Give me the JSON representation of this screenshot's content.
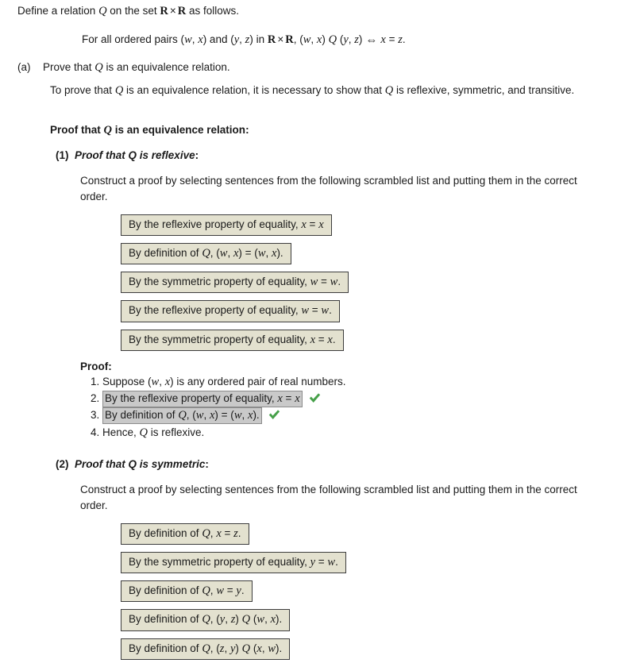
{
  "problem": {
    "intro_prefix": "Define a relation ",
    "intro_var": "Q",
    "intro_mid": " on the set ",
    "intro_set_a": "R",
    "intro_times": "×",
    "intro_set_b": "R",
    "intro_suffix": " as follows.",
    "definition": {
      "t1": "For all ordered pairs (",
      "v1": "w",
      "t2": ", ",
      "v2": "x",
      "t3": ") and (",
      "v3": "y",
      "t4": ", ",
      "v4": "z",
      "t5": ") in ",
      "setA": "R",
      "times": "×",
      "setB": "R",
      "t6": ", (",
      "v5": "w",
      "t7": ", ",
      "v6": "x",
      "t8": ") ",
      "rel1": "Q",
      "t9": " (",
      "v7": "y",
      "t10": ", ",
      "v8": "z",
      "t11": ")",
      "iff": "⇔",
      "v9": "x",
      "t12": " = ",
      "v10": "z",
      "t13": "."
    }
  },
  "part_a": {
    "marker": "(a)",
    "prompt_prefix": "Prove that ",
    "prompt_var": "Q",
    "prompt_suffix": " is an equivalence relation.",
    "to_prove_1": "To prove that ",
    "to_prove_var1": "Q",
    "to_prove_2": " is an equivalence relation, it is necessary to show that ",
    "to_prove_var2": "Q",
    "to_prove_3": " is reflexive, symmetric, and transitive.",
    "proof_heading_1": "Proof that ",
    "proof_heading_var": "Q",
    "proof_heading_2": " is an equivalence relation",
    "proof_heading_colon": ":"
  },
  "sections": [
    {
      "number": "(1)",
      "title_prefix": "Proof that ",
      "title_var": "Q",
      "title_suffix": " is reflexive",
      "title_colon": ":",
      "construct_text": "Construct a proof by selecting sentences from the following scrambled list and putting them in the correct order.",
      "scrambled": [
        {
          "parts": [
            {
              "t": "By the reflexive property of equality, "
            },
            {
              "i": "x"
            },
            {
              "t": " = "
            },
            {
              "i": "x"
            }
          ]
        },
        {
          "parts": [
            {
              "t": "By definition of "
            },
            {
              "i": "Q"
            },
            {
              "t": ", ("
            },
            {
              "i": "w"
            },
            {
              "t": ", "
            },
            {
              "i": "x"
            },
            {
              "t": ") = ("
            },
            {
              "i": "w"
            },
            {
              "t": ", "
            },
            {
              "i": "x"
            },
            {
              "t": ")."
            }
          ]
        },
        {
          "parts": [
            {
              "t": "By the symmetric property of equality, "
            },
            {
              "i": "w"
            },
            {
              "t": " = "
            },
            {
              "i": "w"
            },
            {
              "t": "."
            }
          ]
        },
        {
          "parts": [
            {
              "t": "By the reflexive property of equality, "
            },
            {
              "i": "w"
            },
            {
              "t": " = "
            },
            {
              "i": "w"
            },
            {
              "t": "."
            }
          ]
        },
        {
          "parts": [
            {
              "t": "By the symmetric property of equality, "
            },
            {
              "i": "x"
            },
            {
              "t": " = "
            },
            {
              "i": "x"
            },
            {
              "t": "."
            }
          ]
        }
      ],
      "proof_label": "Proof:",
      "proof_steps": [
        {
          "filled": false,
          "checked": false,
          "parts": [
            {
              "t": "Suppose ("
            },
            {
              "i": "w"
            },
            {
              "t": ", "
            },
            {
              "i": "x"
            },
            {
              "t": ") is any ordered pair of real numbers."
            }
          ]
        },
        {
          "filled": true,
          "checked": true,
          "parts": [
            {
              "t": "By the reflexive property of equality, "
            },
            {
              "i": "x"
            },
            {
              "t": " = "
            },
            {
              "i": "x"
            }
          ]
        },
        {
          "filled": true,
          "checked": true,
          "parts": [
            {
              "t": "By definition of "
            },
            {
              "i": "Q"
            },
            {
              "t": ", ("
            },
            {
              "i": "w"
            },
            {
              "t": ", "
            },
            {
              "i": "x"
            },
            {
              "t": ") = ("
            },
            {
              "i": "w"
            },
            {
              "t": ", "
            },
            {
              "i": "x"
            },
            {
              "t": ")."
            }
          ]
        },
        {
          "filled": false,
          "checked": false,
          "parts": [
            {
              "t": "Hence, "
            },
            {
              "i": "Q"
            },
            {
              "t": " is reflexive."
            }
          ]
        }
      ]
    },
    {
      "number": "(2)",
      "title_prefix": "Proof that ",
      "title_var": "Q",
      "title_suffix": " is symmetric",
      "title_colon": ":",
      "construct_text": "Construct a proof by selecting sentences from the following scrambled list and putting them in the correct order.",
      "scrambled": [
        {
          "parts": [
            {
              "t": "By definition of "
            },
            {
              "i": "Q"
            },
            {
              "t": ", "
            },
            {
              "i": "x"
            },
            {
              "t": " = "
            },
            {
              "i": "z"
            },
            {
              "t": "."
            }
          ]
        },
        {
          "parts": [
            {
              "t": "By the symmetric property of equality, "
            },
            {
              "i": "y"
            },
            {
              "t": " = "
            },
            {
              "i": "w"
            },
            {
              "t": "."
            }
          ]
        },
        {
          "parts": [
            {
              "t": "By definition of "
            },
            {
              "i": "Q"
            },
            {
              "t": ", "
            },
            {
              "i": "w"
            },
            {
              "t": " = "
            },
            {
              "i": "y"
            },
            {
              "t": "."
            }
          ]
        },
        {
          "parts": [
            {
              "t": "By definition of "
            },
            {
              "i": "Q"
            },
            {
              "t": ", ("
            },
            {
              "i": "y"
            },
            {
              "t": ", "
            },
            {
              "i": "z"
            },
            {
              "t": ") "
            },
            {
              "i": "Q"
            },
            {
              "t": " ("
            },
            {
              "i": "w"
            },
            {
              "t": ", "
            },
            {
              "i": "x"
            },
            {
              "t": ")."
            }
          ]
        },
        {
          "parts": [
            {
              "t": "By definition of "
            },
            {
              "i": "Q"
            },
            {
              "t": ", ("
            },
            {
              "i": "z"
            },
            {
              "t": ", "
            },
            {
              "i": "y"
            },
            {
              "t": ") "
            },
            {
              "i": "Q"
            },
            {
              "t": " ("
            },
            {
              "i": "x"
            },
            {
              "t": ", "
            },
            {
              "i": "w"
            },
            {
              "t": ")."
            }
          ]
        }
      ],
      "proof_label": null,
      "proof_steps": []
    }
  ],
  "colors": {
    "scrambled_box_bg": "#e3e1cf",
    "scrambled_box_border": "#3d3d3d",
    "filled_box_bg": "#c9c9c9",
    "filled_box_border": "#8c8c8c",
    "check_green": "#46a049",
    "page_bg": "#ffffff",
    "text": "#1a1a1a"
  },
  "icons": {
    "correct": "check-mark-icon"
  }
}
